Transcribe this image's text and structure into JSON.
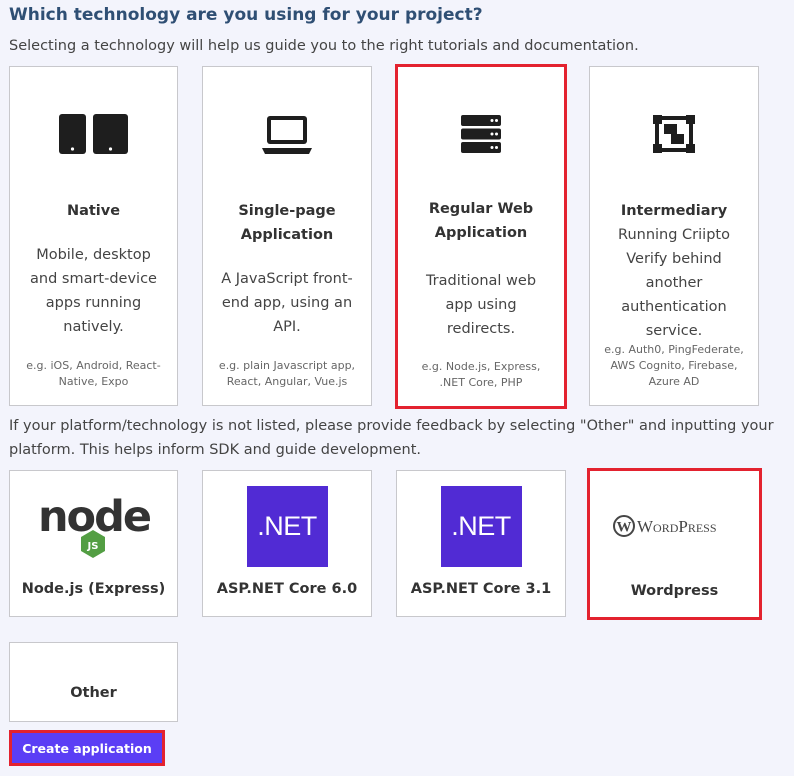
{
  "header": {
    "title": "Which technology are you using for your project?",
    "subtitle": "Selecting a technology will help us guide you to the right tutorials and documentation."
  },
  "technologies": [
    {
      "title": "Native",
      "description": [
        "Mobile, desktop",
        "and smart-device",
        "apps running",
        "natively."
      ],
      "examples": [
        "e.g. iOS, Android, React-",
        "Native, Expo"
      ],
      "icon": "tablets-icon",
      "selected": false
    },
    {
      "title": [
        "Single-page",
        "Application"
      ],
      "description": [
        "A JavaScript front-",
        "end app, using an",
        "API."
      ],
      "examples": [
        "e.g. plain Javascript app,",
        "React, Angular, Vue.js"
      ],
      "icon": "laptop-icon",
      "selected": false
    },
    {
      "title": [
        "Regular Web",
        "Application"
      ],
      "description": [
        "Traditional web",
        "app using",
        "redirects."
      ],
      "examples": [
        "e.g. Node.js, Express,",
        ".NET Core, PHP"
      ],
      "icon": "server-icon",
      "selected": true
    },
    {
      "title": "Intermediary",
      "description": [
        "Running Criipto",
        "Verify behind",
        "another",
        "authentication",
        "service."
      ],
      "examples": [
        "e.g. Auth0, PingFederate,",
        "AWS Cognito, Firebase,",
        "Azure AD"
      ],
      "icon": "intermediary-icon",
      "selected": false
    }
  ],
  "platform_info": [
    "If your platform/technology is not listed, please provide feedback by selecting \"Other\" and inputting your",
    "platform. This helps inform SDK and guide development."
  ],
  "platforms": [
    {
      "label": "Node.js (Express)",
      "logo": "nodejs-logo",
      "logo_text": "node",
      "logo_badge": "JS",
      "selected": false
    },
    {
      "label": "ASP.NET Core 6.0",
      "logo": "dotnet-logo",
      "logo_text": ".NET",
      "selected": false
    },
    {
      "label": "ASP.NET Core 3.1",
      "logo": "dotnet-logo",
      "logo_text": ".NET",
      "selected": false
    },
    {
      "label": "Wordpress",
      "logo": "wordpress-logo",
      "logo_text": "WordPress",
      "selected": true
    },
    {
      "label": "Other",
      "selected": false
    }
  ],
  "actions": {
    "create_label": "Create application"
  },
  "colors": {
    "selected_border": "#e3222f",
    "button": "#5b3ef5",
    "dotnet": "#512bd4",
    "heading": "#2f4f74"
  }
}
